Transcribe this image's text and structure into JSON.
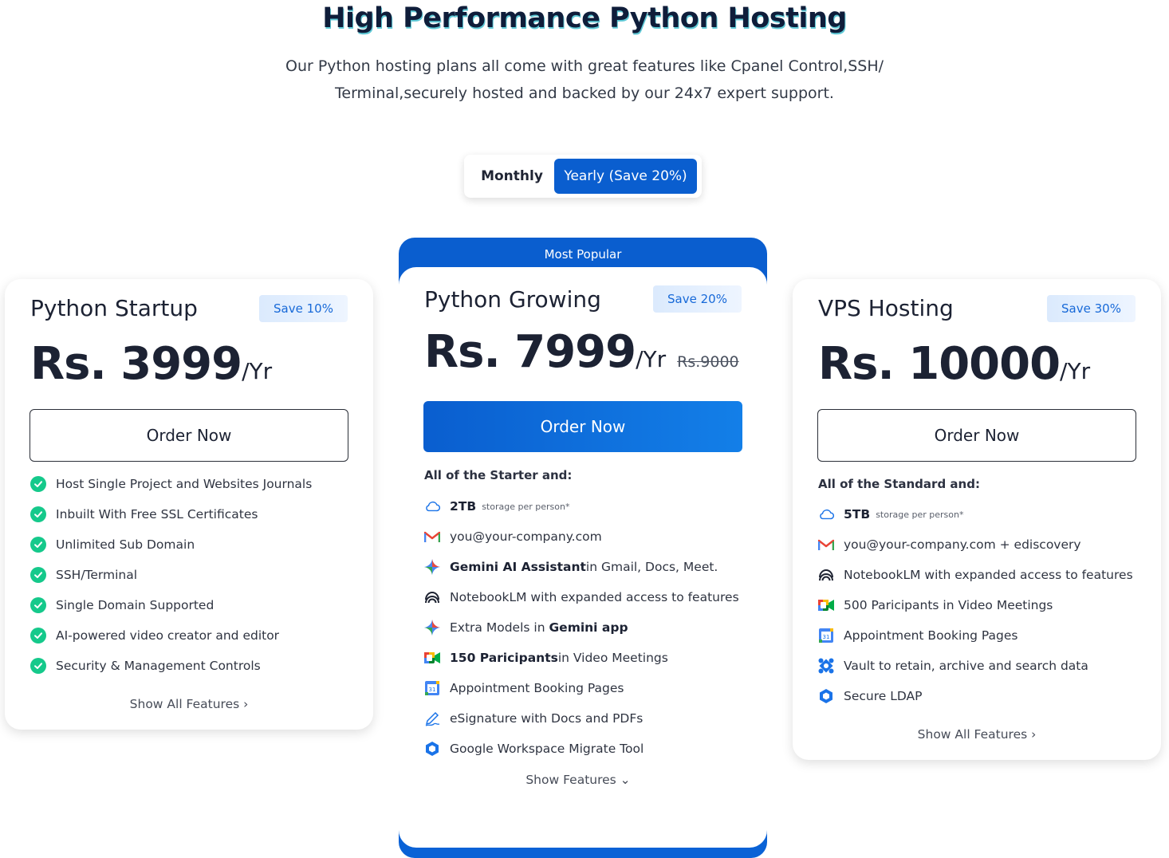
{
  "header": {
    "title": "High Performance Python Hosting",
    "subtitle_line1": "Our Python hosting plans all come with great features like Cpanel Control,SSH/",
    "subtitle_line2": "Terminal,securely hosted and backed by our 24x7 expert support."
  },
  "billing_toggle": {
    "monthly_label": "Monthly",
    "yearly_label": "Yearly (Save 20%)",
    "selected": "yearly"
  },
  "colors": {
    "accent": "#0a5ecf",
    "check": "#15c98b",
    "heading_shadow": "#5fc9d6"
  },
  "plans": [
    {
      "name": "Python Startup",
      "badge": "Save 10%",
      "price": "Rs. 3999",
      "period": "/Yr",
      "button": "Order Now",
      "features": [
        "Host Single Project and Websites Journals",
        "Inbuilt With Free SSL Certificates",
        "Unlimited Sub Domain",
        "SSH/Terminal",
        "Single Domain Supported",
        "AI-powered video creator and editor",
        "Security & Management Controls"
      ],
      "show_link": "Show All Features ›"
    },
    {
      "name": "Python Growing",
      "ribbon": "Most Popular",
      "badge": "Save 20%",
      "price": "Rs. 7999",
      "period": "/Yr",
      "old_price": "Rs.9000",
      "button": "Order Now",
      "intro": "All of the Starter and:",
      "features": [
        {
          "icon": "cloud-icon",
          "bold": "2TB",
          "small": "storage per person*"
        },
        {
          "icon": "gmail-icon",
          "text": "you@your-company.com"
        },
        {
          "icon": "gemini-icon",
          "bold": "Gemini AI Assistant",
          "text": " in Gmail, Docs, Meet."
        },
        {
          "icon": "notebooklm-icon",
          "text": "NotebookLM with expanded access to features"
        },
        {
          "icon": "gemini-icon",
          "text": "Extra Models in ",
          "bold": "Gemini app"
        },
        {
          "icon": "meet-icon",
          "bold": "150 Paricipants",
          "text": " in Video Meetings"
        },
        {
          "icon": "calendar-icon",
          "text": "Appointment Booking Pages"
        },
        {
          "icon": "signature-icon",
          "text": "eSignature with Docs and PDFs"
        },
        {
          "icon": "migrate-icon",
          "text": "Google Workspace Migrate Tool"
        }
      ],
      "show_link": "Show Features ⌄"
    },
    {
      "name": "VPS Hosting",
      "badge": "Save 30%",
      "price": "Rs. 10000",
      "period": "/Yr",
      "button": "Order Now",
      "intro": "All of the Standard and:",
      "features": [
        {
          "icon": "cloud-icon",
          "bold": "5TB",
          "small": "storage per person*"
        },
        {
          "icon": "gmail-icon",
          "text": "you@your-company.com + ediscovery"
        },
        {
          "icon": "notebooklm-icon",
          "text": "NotebookLM with expanded access to features"
        },
        {
          "icon": "meet-icon",
          "text": "500 Paricipants in Video Meetings"
        },
        {
          "icon": "calendar-icon",
          "text": "Appointment Booking Pages"
        },
        {
          "icon": "vault-icon",
          "text": "Vault to retain, archive and search data"
        },
        {
          "icon": "ldap-icon",
          "text": "Secure LDAP"
        }
      ],
      "show_link": "Show All Features ›"
    }
  ]
}
